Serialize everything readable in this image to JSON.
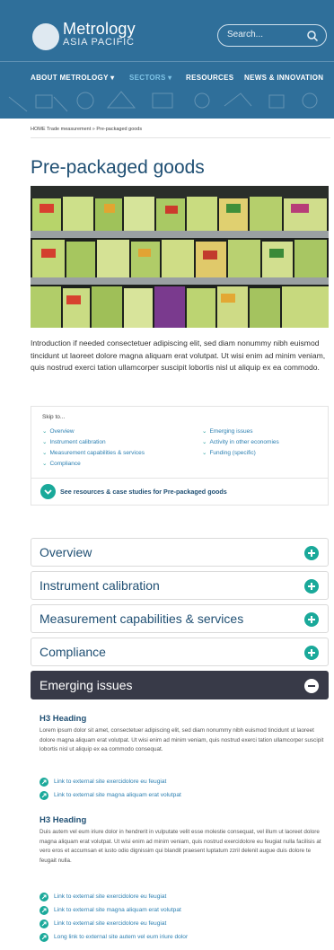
{
  "brand": {
    "name": "Metrology",
    "region": "ASIA PACIFIC"
  },
  "search": {
    "placeholder": "Search..."
  },
  "nav": {
    "items": [
      {
        "label": "ABOUT METROLOGY",
        "caret": "▾"
      },
      {
        "label": "SECTORS",
        "caret": "▾"
      },
      {
        "label": "RESOURCES"
      },
      {
        "label": "NEWS & INNOVATION"
      }
    ],
    "active_color": "#7ec3e6"
  },
  "breadcrumb": "HOME  Trade measurement  »  Pre-packaged goods",
  "page": {
    "title": "Pre-packaged goods",
    "intro": "Introduction if needed consectetuer adipiscing elit, sed diam nonummy nibh euismod tincidunt ut laoreet dolore magna aliquam erat volutpat. Ut wisi enim ad minim veniam, quis nostrud exerci tation ullamcorper suscipit lobortis nisl ut aliquip ex ea commodo."
  },
  "skip": {
    "title": "Skip to...",
    "chevron": "⌄",
    "left": [
      "Overview",
      "Instrument calibration",
      "Measurement capabilities & services",
      "Compliance"
    ],
    "right": [
      "Emerging issues",
      "Activity in other economies",
      "Funding (specific)"
    ],
    "resources_link": "See resources & case studies for Pre-packaged goods"
  },
  "accordion": [
    {
      "label": "Overview",
      "state": "collapsed"
    },
    {
      "label": "Instrument calibration",
      "state": "collapsed"
    },
    {
      "label": "Measurement capabilities & services",
      "state": "collapsed"
    },
    {
      "label": "Compliance",
      "state": "collapsed"
    },
    {
      "label": "Emerging issues",
      "state": "expanded"
    }
  ],
  "emerging": {
    "sections": [
      {
        "heading": "H3 Heading",
        "body": "Lorem ipsum dolor sit amet, consectetuer adipiscing elit, sed diam nonummy nibh euismod tincidunt ut laoreet dolore magna aliquam erat volutpat. Ut wisi enim ad minim veniam, quis nostrud exerci tation ullamcorper suscipit lobortis nisl ut aliquip ex ea commodo consequat.",
        "links": [
          "Link to external site exercidolore eu feugiat",
          "Link to external site magna aliquam erat volutpat"
        ]
      },
      {
        "heading": "H3 Heading",
        "body": "Duis autem vel eum iriure dolor in hendrerit in vulputate velit esse molestie consequat, vel illum ut laoreet dolore magna aliquam erat volutpat. Ut wisi enim ad minim veniam, quis nostrud exercidolore eu feugiat nulla facilisis at vero eros et accumsan et iusto odio dignissim qui blandit praesent luptatum zzril delenit augue duis dolore te feugait nulla.",
        "links": [
          "Link to external site exercidolore eu feugiat",
          "Link to external site magna aliquam erat volutpat",
          "Link to external site exercidolore eu feugiat",
          "Long link to external site autem vel eum iriure dolor"
        ]
      }
    ]
  },
  "colors": {
    "header_bg": "#2f6f9a",
    "title": "#1f4f73",
    "teal": "#1aa99a",
    "link": "#2b7fb1",
    "expanded_bg": "#383a48"
  },
  "icons": {
    "logo": "logo-circle",
    "search": "search-icon",
    "plus": "plus-icon",
    "minus": "minus-icon",
    "chevron": "chevron-down-icon",
    "external": "external-link-icon"
  }
}
